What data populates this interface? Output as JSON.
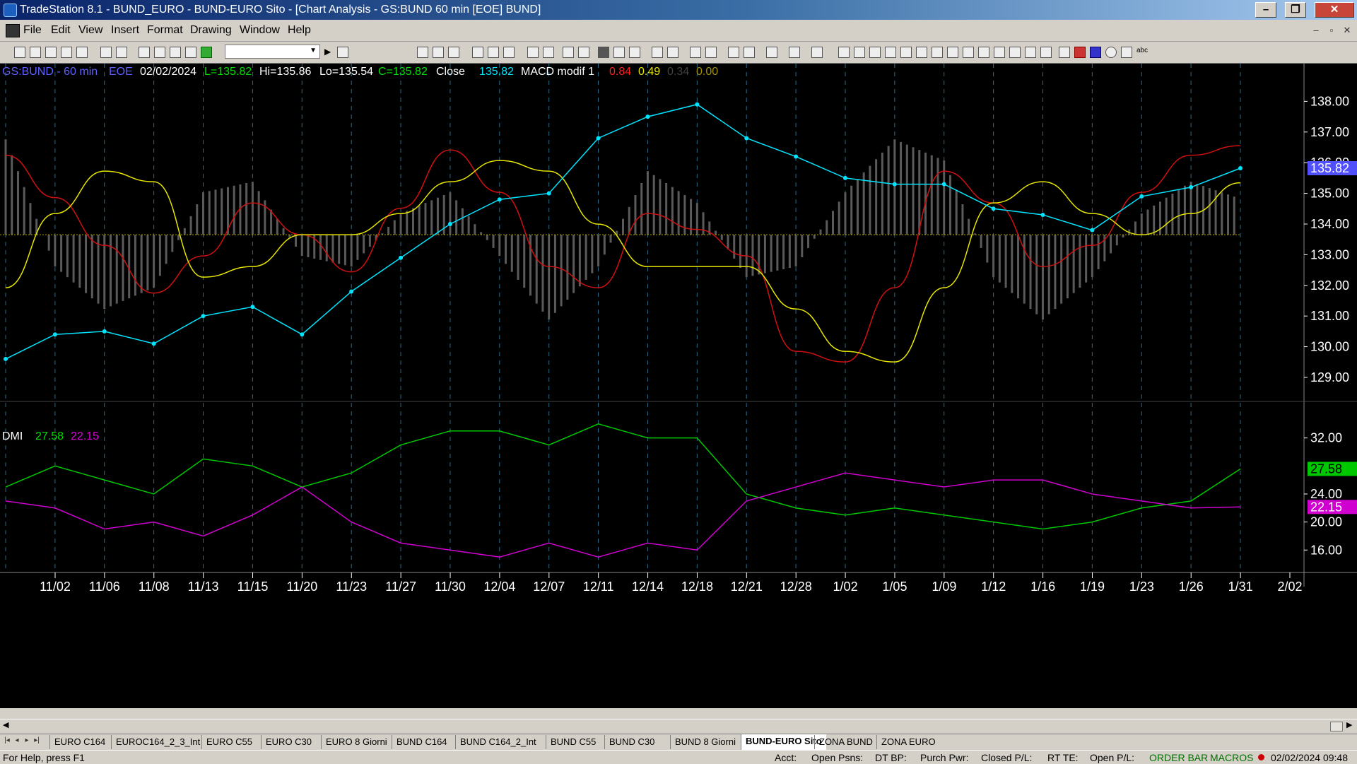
{
  "window": {
    "title": "TradeStation 8.1 - BUND_EURO - BUND-EURO Sito - [Chart Analysis - GS:BUND  60 min  [EOE] BUND]",
    "minimize": "–",
    "restore": "❐",
    "close": "✕"
  },
  "menu": [
    "File",
    "Edit",
    "View",
    "Insert",
    "Format",
    "Drawing",
    "Window",
    "Help"
  ],
  "mdi_controls": [
    "–",
    "▫",
    "✕"
  ],
  "chart_header": {
    "symbol": "GS:BUND - 60 min",
    "exchange": "EOE",
    "date": "02/02/2024",
    "last": "L=135.82",
    "high": "Hi=135.86",
    "low": "Lo=135.54",
    "close_val": "C=135.82",
    "close_label": "Close",
    "close_price": "135.82",
    "macd_label": "MACD modif 1",
    "macd_v1": "0.84",
    "macd_v2": "0.49",
    "macd_v3": "0.34",
    "macd_v4": "0.00"
  },
  "dmi_header": {
    "label": "DMI",
    "plus": "27.58",
    "minus": "22.15"
  },
  "price_axis": {
    "ticks": [
      "138.00",
      "137.00",
      "136.00",
      "135.00",
      "134.00",
      "133.00",
      "132.00",
      "131.00",
      "130.00",
      "129.00"
    ],
    "last_label": "135.82"
  },
  "dmi_axis": {
    "ticks": [
      "32.00",
      "24.00",
      "20.00",
      "16.00"
    ],
    "plus_label": "27.58",
    "minus_label": "22.15"
  },
  "date_axis": [
    "11/02",
    "11/06",
    "11/08",
    "11/13",
    "11/15",
    "11/20",
    "11/23",
    "11/27",
    "11/30",
    "12/04",
    "12/07",
    "12/11",
    "12/14",
    "12/18",
    "12/21",
    "12/28",
    "1/02",
    "1/05",
    "1/09",
    "1/12",
    "1/16",
    "1/19",
    "1/23",
    "1/26",
    "1/31",
    "2/02"
  ],
  "tabs": [
    "EURO C164",
    "EUROC164_2_3_Int",
    "EURO C55",
    "EURO C30",
    "EURO 8 Giorni",
    "BUND C164",
    "BUND C164_2_Int",
    "BUND C55",
    "BUND  C30",
    "BUND 8 Giorni",
    "BUND-EURO Sito",
    "ZONA BUND",
    "ZONA EURO"
  ],
  "active_tab": "BUND-EURO Sito",
  "status": {
    "help": "For Help, press F1",
    "acct": "Acct:",
    "open_psns": "Open Psns:",
    "dt_bp": "DT BP:",
    "purch_pwr": "Purch Pwr:",
    "closed_pl": "Closed P/L:",
    "rt_te": "RT TE:",
    "open_pl": "Open P/L:",
    "order_bar": "ORDER BAR",
    "macros": "MACROS",
    "datetime": "02/02/2024 09:48"
  },
  "colors": {
    "price": "#00e5ff",
    "macd_red": "#d01010",
    "macd_yellow": "#e6e600",
    "histogram": "#5a5a5a",
    "dmi_plus": "#00c800",
    "dmi_minus": "#d000d0",
    "zero_line": "#b0a000",
    "last_price_bg": "#5050ff"
  },
  "chart_data": [
    {
      "type": "line",
      "title": "GS:BUND - 60 min",
      "x": [
        "11/02",
        "11/06",
        "11/08",
        "11/13",
        "11/15",
        "11/20",
        "11/23",
        "11/27",
        "11/30",
        "12/04",
        "12/07",
        "12/11",
        "12/14",
        "12/18",
        "12/21",
        "12/28",
        "1/02",
        "1/05",
        "1/09",
        "1/12",
        "1/16",
        "1/19",
        "1/23",
        "1/26",
        "1/31",
        "2/02"
      ],
      "series": [
        {
          "name": "Close",
          "values": [
            129.6,
            130.4,
            130.5,
            130.1,
            131.0,
            131.3,
            130.4,
            131.8,
            132.9,
            134.0,
            134.8,
            135.0,
            136.8,
            137.5,
            137.9,
            136.8,
            136.2,
            135.5,
            135.3,
            135.3,
            134.5,
            134.3,
            133.8,
            134.9,
            135.2,
            135.82
          ]
        }
      ],
      "ylim": [
        128.4,
        139.0
      ]
    },
    {
      "type": "line",
      "title": "MACD modif 1",
      "x": [
        "11/02",
        "11/06",
        "11/08",
        "11/13",
        "11/15",
        "11/20",
        "11/23",
        "11/27",
        "11/30",
        "12/04",
        "12/07",
        "12/11",
        "12/14",
        "12/18",
        "12/21",
        "12/28",
        "1/02",
        "1/05",
        "1/09",
        "1/12",
        "1/16",
        "1/19",
        "1/23",
        "1/26",
        "1/31",
        "2/02"
      ],
      "series": [
        {
          "name": "0.84",
          "values": [
            0.75,
            0.35,
            -0.1,
            -0.55,
            -0.2,
            0.3,
            0.0,
            -0.35,
            0.25,
            0.8,
            0.4,
            -0.3,
            -0.5,
            0.2,
            0.05,
            -0.2,
            -1.1,
            -1.2,
            -0.5,
            0.6,
            0.3,
            -0.3,
            -0.1,
            0.4,
            0.75,
            0.84
          ]
        },
        {
          "name": "0.49",
          "values": [
            -0.5,
            0.2,
            0.6,
            0.5,
            -0.4,
            -0.3,
            0.0,
            0.0,
            0.2,
            0.5,
            0.7,
            0.6,
            0.1,
            -0.3,
            -0.3,
            -0.3,
            -0.7,
            -1.1,
            -1.2,
            -0.5,
            0.3,
            0.5,
            0.2,
            0.0,
            0.2,
            0.49
          ]
        },
        {
          "name": "0.34",
          "values": [
            0.9,
            -0.3,
            -0.7,
            -0.5,
            0.4,
            0.5,
            -0.2,
            -0.3,
            0.2,
            0.4,
            -0.2,
            -0.8,
            -0.3,
            0.6,
            0.3,
            -0.4,
            -0.3,
            0.4,
            0.9,
            0.7,
            -0.4,
            -0.8,
            -0.4,
            0.2,
            0.5,
            0.34
          ]
        }
      ]
    },
    {
      "type": "line",
      "title": "DMI",
      "x": [
        "11/02",
        "11/06",
        "11/08",
        "11/13",
        "11/15",
        "11/20",
        "11/23",
        "11/27",
        "11/30",
        "12/04",
        "12/07",
        "12/11",
        "12/14",
        "12/18",
        "12/21",
        "12/28",
        "1/02",
        "1/05",
        "1/09",
        "1/12",
        "1/16",
        "1/19",
        "1/23",
        "1/26",
        "1/31",
        "2/02"
      ],
      "series": [
        {
          "name": "27.58",
          "values": [
            25,
            28,
            26,
            24,
            29,
            28,
            25,
            27,
            31,
            33,
            33,
            31,
            34,
            32,
            32,
            24,
            22,
            21,
            22,
            21,
            20,
            19,
            20,
            22,
            23,
            27.58
          ]
        },
        {
          "name": "22.15",
          "values": [
            23,
            22,
            19,
            20,
            18,
            21,
            25,
            20,
            17,
            16,
            15,
            17,
            15,
            17,
            16,
            23,
            25,
            27,
            26,
            25,
            26,
            26,
            24,
            23,
            22,
            22.15
          ]
        }
      ],
      "ylim": [
        13.0,
        36.0
      ]
    }
  ]
}
